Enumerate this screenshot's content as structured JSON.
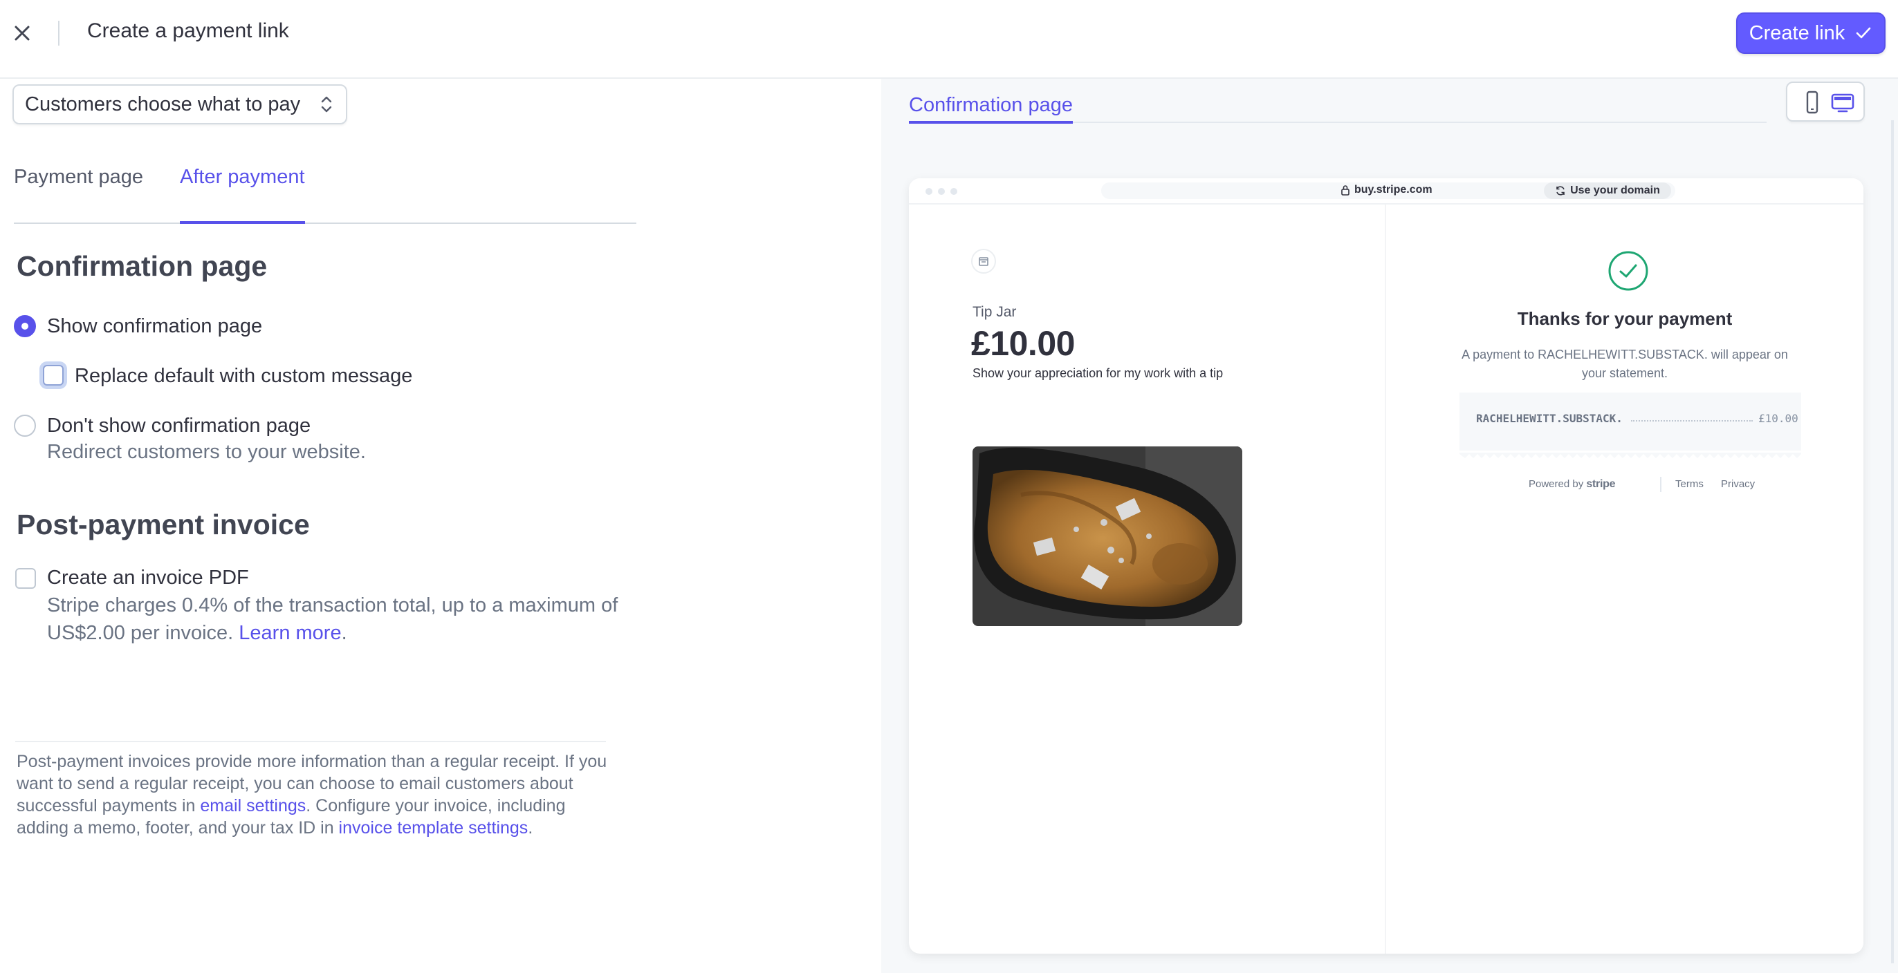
{
  "header": {
    "title": "Create a payment link",
    "create_button": "Create link"
  },
  "left": {
    "price_select": "Customers choose what to pay",
    "tabs": [
      {
        "label": "Payment page"
      },
      {
        "label": "After payment"
      }
    ],
    "confirmation_heading": "Confirmation page",
    "show_confirmation_label": "Show confirmation page",
    "replace_default_label": "Replace default with custom message",
    "dont_show_label": "Don't show confirmation page",
    "dont_show_sub": "Redirect customers to your website.",
    "invoice_heading": "Post-payment invoice",
    "create_invoice_label": "Create an invoice PDF",
    "invoice_sub": "Stripe charges 0.4% of the transaction total, up to a maximum of US$2.00 per invoice.",
    "learn_more": "Learn more",
    "period": ".",
    "note_part1": "Post-payment invoices provide more information than a regular receipt. If you want to send a regular receipt, you can choose to email customers about successful payments in ",
    "email_settings": "email settings",
    "note_part2": ". Configure your invoice, including adding a memo, footer, and your tax ID in ",
    "invoice_template_settings": "invoice template settings",
    "note_part3": "."
  },
  "preview": {
    "tab": "Confirmation page",
    "url": "buy.stripe.com",
    "use_domain": "Use your domain",
    "product": {
      "name": "Tip Jar",
      "price": "£10.00",
      "description": "Show your appreciation for my work with a tip"
    },
    "thanks_title": "Thanks for your payment",
    "thanks_sub": "A payment to RACHELHEWITT.SUBSTACK. will appear on your statement.",
    "receipt_name": "RACHELHEWITT.SUBSTACK.",
    "receipt_amount": "£10.00",
    "powered_by": "Powered by",
    "stripe": "stripe",
    "terms": "Terms",
    "privacy": "Privacy"
  },
  "colors": {
    "accent": "#635bff",
    "accent_text": "#5851ea",
    "success": "#1ea672"
  }
}
